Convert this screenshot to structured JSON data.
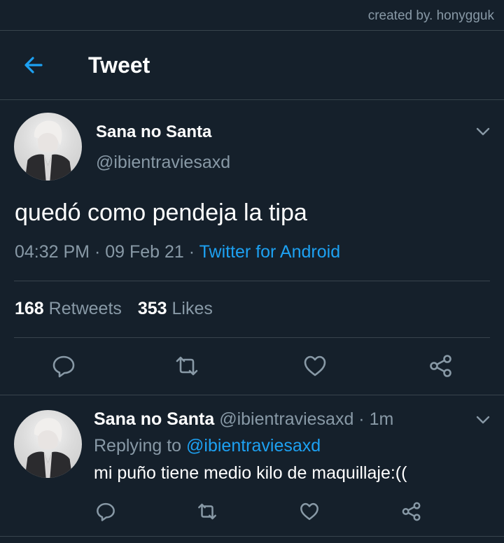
{
  "credit": "created by. honygguk",
  "header": {
    "title": "Tweet",
    "back_icon": "arrow-left-icon"
  },
  "tweet": {
    "name": "Sana no Santa",
    "handle": "@ibientraviesaxd",
    "text": "quedó como pendeja la tipa",
    "time": "04:32 PM",
    "date": "09 Feb 21",
    "source": "Twitter for Android",
    "retweets_count": "168",
    "retweets_label": "Retweets",
    "likes_count": "353",
    "likes_label": "Likes",
    "actions": [
      "reply-icon",
      "retweet-icon",
      "like-icon",
      "share-icon"
    ]
  },
  "reply": {
    "name": "Sana no Santa",
    "handle": "@ibientraviesaxd",
    "age": "1m",
    "replying_prefix": "Replying to",
    "replying_to": "@ibientraviesaxd",
    "text": "mi puño tiene medio kilo de maquillaje:(("
  },
  "colors": {
    "background": "#15202b",
    "accent": "#1da1f2",
    "secondary_text": "#8899a6",
    "divider": "#38444d"
  }
}
